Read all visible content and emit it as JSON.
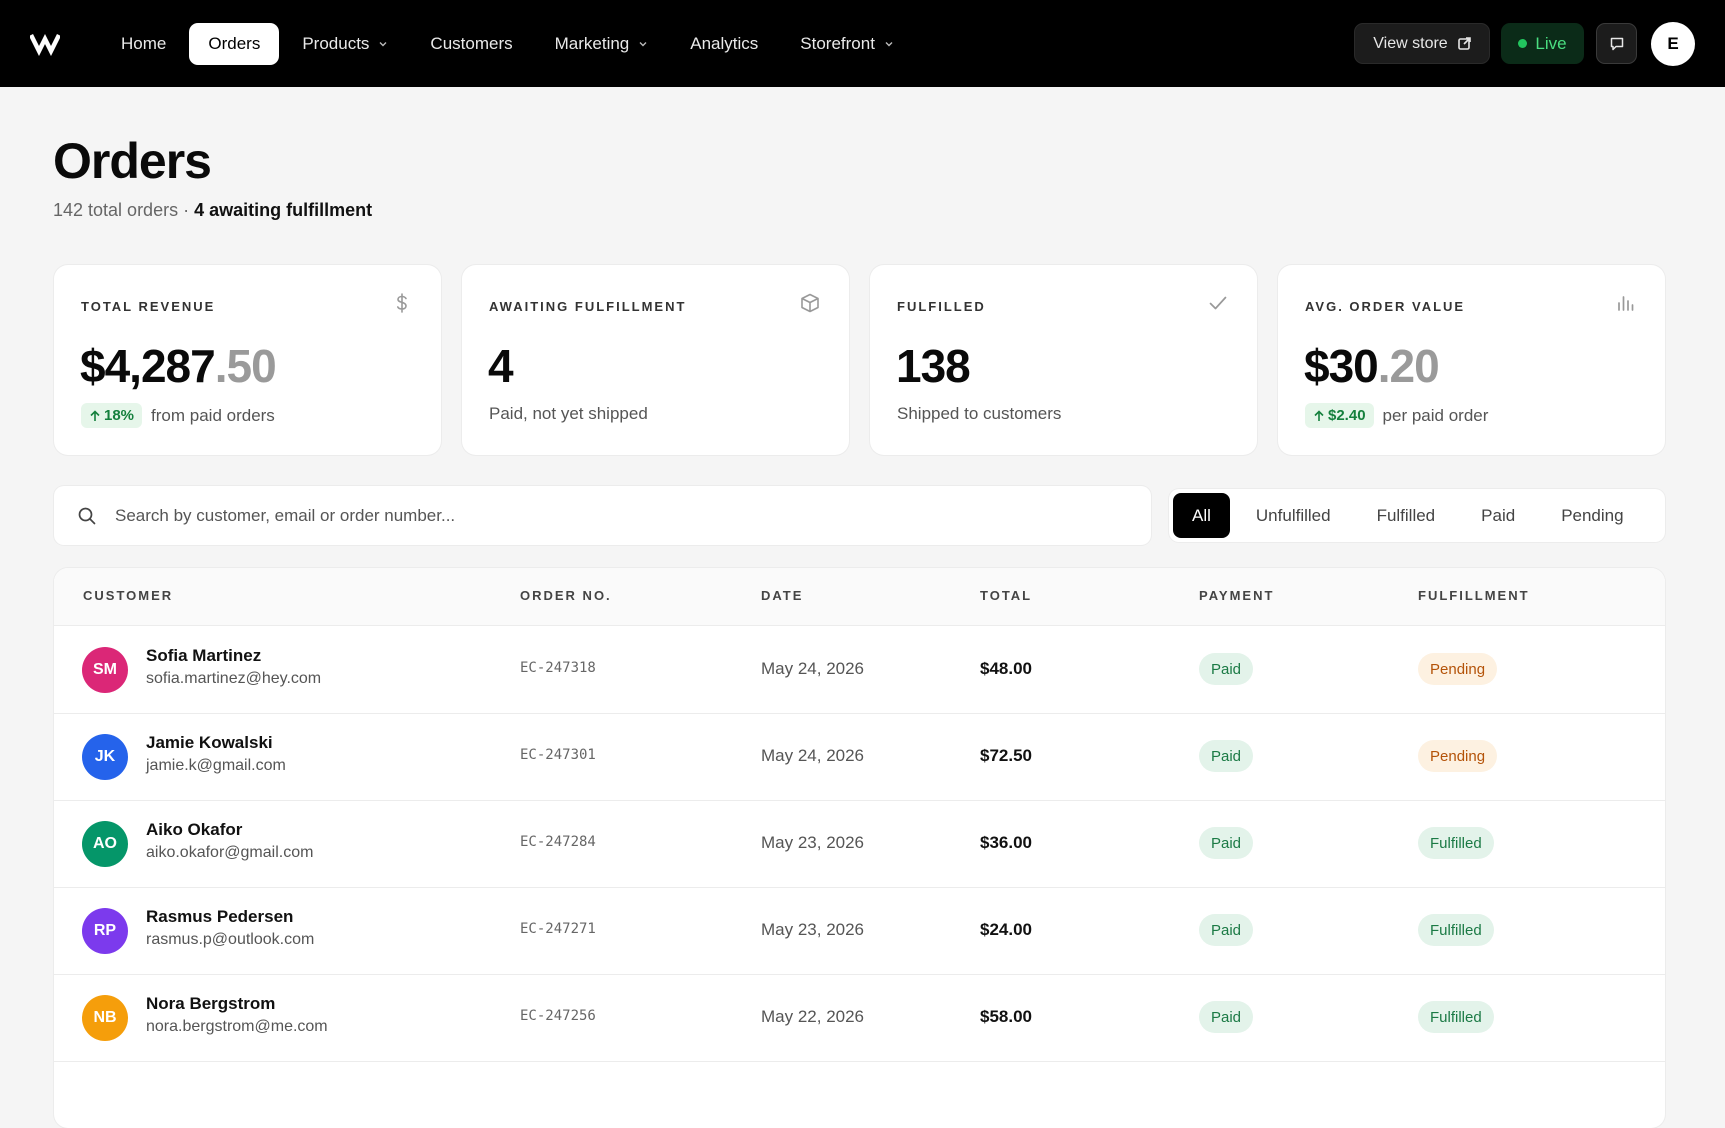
{
  "nav": {
    "items": [
      {
        "label": "Home",
        "dropdown": false,
        "active": false
      },
      {
        "label": "Orders",
        "dropdown": false,
        "active": true
      },
      {
        "label": "Products",
        "dropdown": true,
        "active": false
      },
      {
        "label": "Customers",
        "dropdown": false,
        "active": false
      },
      {
        "label": "Marketing",
        "dropdown": true,
        "active": false
      },
      {
        "label": "Analytics",
        "dropdown": false,
        "active": false
      },
      {
        "label": "Storefront",
        "dropdown": true,
        "active": false
      }
    ],
    "view_store": "View store",
    "live": "Live",
    "user_initial": "E"
  },
  "page": {
    "title": "Orders",
    "subtitle_total": "142 total orders",
    "subtitle_sep": " · ",
    "subtitle_awaiting": "4 awaiting fulfillment"
  },
  "stats": {
    "revenue": {
      "label": "TOTAL REVENUE",
      "value_int": "$4,287",
      "value_dec": ".50",
      "delta": "18%",
      "note": "from paid orders",
      "icon": "dollar-icon"
    },
    "awaiting": {
      "label": "AWAITING FULFILLMENT",
      "value": "4",
      "note": "Paid, not yet shipped",
      "icon": "box-icon"
    },
    "fulfilled": {
      "label": "FULFILLED",
      "value": "138",
      "note": "Shipped to customers",
      "icon": "check-icon"
    },
    "avg": {
      "label": "AVG. ORDER VALUE",
      "value_int": "$30",
      "value_dec": ".20",
      "delta": "$2.40",
      "note": "per paid order",
      "icon": "bar-chart-icon"
    }
  },
  "search": {
    "placeholder": "Search by customer, email or order number..."
  },
  "filters": [
    {
      "label": "All",
      "active": true
    },
    {
      "label": "Unfulfilled",
      "active": false
    },
    {
      "label": "Fulfilled",
      "active": false
    },
    {
      "label": "Paid",
      "active": false
    },
    {
      "label": "Pending",
      "active": false
    }
  ],
  "table": {
    "headers": {
      "customer": "CUSTOMER",
      "order": "ORDER NO.",
      "date": "DATE",
      "total": "TOTAL",
      "payment": "PAYMENT",
      "fulfillment": "FULFILLMENT"
    },
    "rows": [
      {
        "initials": "SM",
        "color": "#db2777",
        "name": "Sofia Martinez",
        "email": "sofia.martinez@hey.com",
        "order": "EC-247318",
        "date": "May 24, 2026",
        "total": "$48.00",
        "payment": "Paid",
        "fulfillment": "Pending"
      },
      {
        "initials": "JK",
        "color": "#2563eb",
        "name": "Jamie Kowalski",
        "email": "jamie.k@gmail.com",
        "order": "EC-247301",
        "date": "May 24, 2026",
        "total": "$72.50",
        "payment": "Paid",
        "fulfillment": "Pending"
      },
      {
        "initials": "AO",
        "color": "#059669",
        "name": "Aiko Okafor",
        "email": "aiko.okafor@gmail.com",
        "order": "EC-247284",
        "date": "May 23, 2026",
        "total": "$36.00",
        "payment": "Paid",
        "fulfillment": "Fulfilled"
      },
      {
        "initials": "RP",
        "color": "#7c3aed",
        "name": "Rasmus Pedersen",
        "email": "rasmus.p@outlook.com",
        "order": "EC-247271",
        "date": "May 23, 2026",
        "total": "$24.00",
        "payment": "Paid",
        "fulfillment": "Fulfilled"
      },
      {
        "initials": "NB",
        "color": "#f59e0b",
        "name": "Nora Bergstrom",
        "email": "nora.bergstrom@me.com",
        "order": "EC-247256",
        "date": "May 22, 2026",
        "total": "$58.00",
        "payment": "Paid",
        "fulfillment": "Fulfilled"
      }
    ]
  }
}
